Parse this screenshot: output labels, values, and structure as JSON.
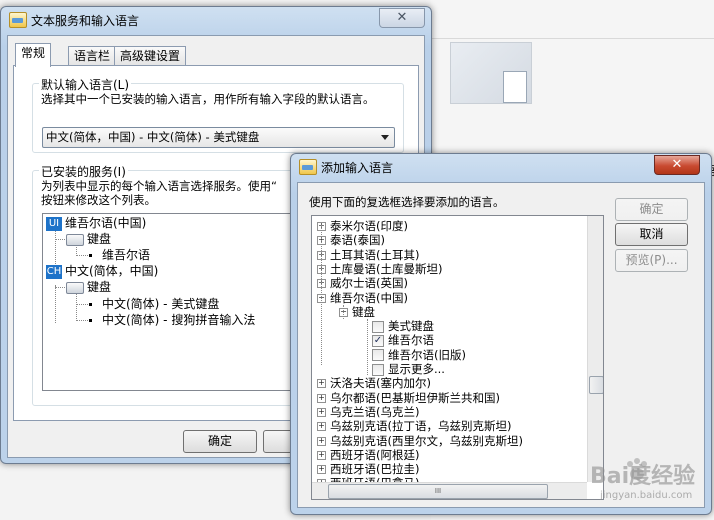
{
  "main_window": {
    "title": "文本服务和输入语言",
    "close_glyph": "✕",
    "tabs": [
      "常规",
      "语言栏",
      "高级键设置"
    ],
    "default_group_label": "默认输入语言(L)",
    "default_desc": "选择其中一个已安装的输入语言，用作所有输入字段的默认语言。",
    "default_value": "中文(简体，中国) - 中文(简体) - 美式键盘",
    "installed_group_label": "已安装的服务(I)",
    "installed_desc_1": "为列表中显示的每个输入语言选择服务。使用“",
    "installed_desc_2": "按钮来修改这个列表。",
    "tree": {
      "lang1_badge": "UI",
      "lang1": "维吾尔语(中国)",
      "lang1_kbd": "键盘",
      "lang1_item": "维吾尔语",
      "lang2_badge": "CH",
      "lang2": "中文(简体，中国)",
      "lang2_kbd": "键盘",
      "lang2_items": [
        "中文(简体) - 美式键盘",
        "中文(简体) - 搜狗拼音输入法"
      ]
    },
    "ok_label": "确定"
  },
  "add_dialog": {
    "title": "添加输入语言",
    "close_glyph": "✕",
    "instruction": "使用下面的复选框选择要添加的语言。",
    "buttons": {
      "ok": "确定",
      "cancel": "取消",
      "preview": "预览(P)..."
    },
    "list_before": [
      "泰米尔语(印度)",
      "泰语(泰国)",
      "土耳其语(土耳其)",
      "土库曼语(土库曼斯坦)",
      "威尔士语(英国)"
    ],
    "expanded_lang": "维吾尔语(中国)",
    "keyboard_node": "键盘",
    "keyboard_options": [
      {
        "label": "美式键盘",
        "checked": false
      },
      {
        "label": "维吾尔语",
        "checked": true
      },
      {
        "label": "维吾尔语(旧版)",
        "checked": false
      },
      {
        "label": "显示更多...",
        "checked": false
      }
    ],
    "list_after": [
      "沃洛夫语(塞内加尔)",
      "乌尔都语(巴基斯坦伊斯兰共和国)",
      "乌克兰语(乌克兰)",
      "乌兹别克语(拉丁语，乌兹别克斯坦)",
      "乌兹别克语(西里尔文，乌兹别克斯坦)",
      "西班牙语(阿根廷)",
      "西班牙语(巴拉圭)",
      "西班牙语(巴拿马)"
    ],
    "hscroll_grip": "III"
  },
  "background": {
    "partial_text": "语"
  },
  "watermark": {
    "text": "Bai度经验",
    "url": "jingyan.baidu.com"
  },
  "colors": {
    "accent_blue": "#1e73c9",
    "close_red": "#c94a31",
    "title_bar": "#b9d0e9"
  }
}
